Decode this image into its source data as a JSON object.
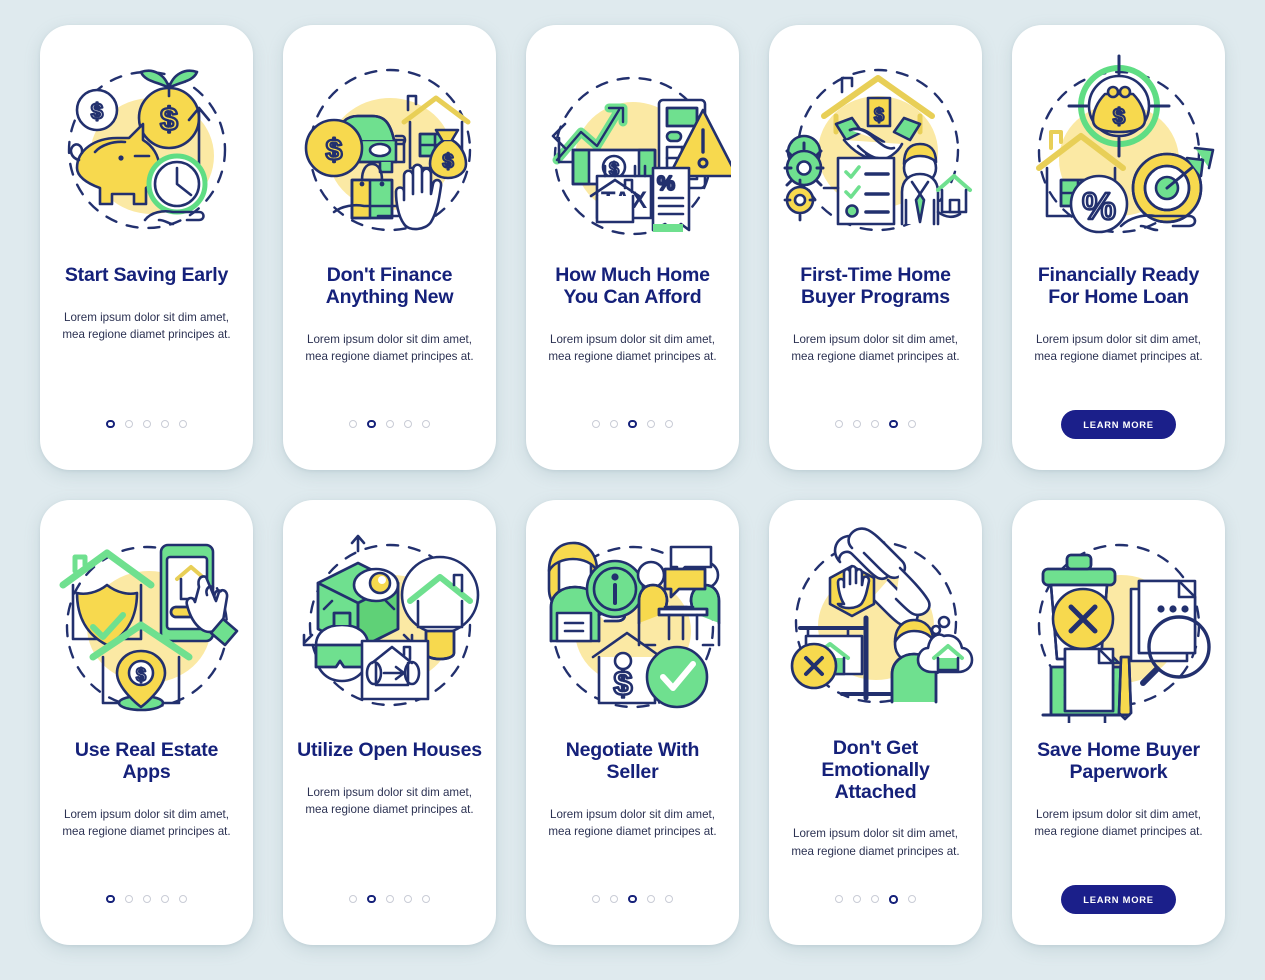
{
  "page": {
    "background_color": "#dfeaee",
    "card_background": "#ffffff",
    "title_color": "#15217a",
    "body_color": "#2b3152",
    "accent_navy": "#1b1f8a",
    "accent_green": "#5fdd84",
    "accent_yellow": "#f7d94e",
    "blob_yellow": "#fbe9a4",
    "dot_inactive": "#c9ccd6"
  },
  "shared": {
    "description": "Lorem ipsum dolor sit dim amet, mea regione diamet principes at.",
    "learn_more_label": "LEARN MORE",
    "dot_count": 5
  },
  "cards": [
    {
      "id": "start-saving-early",
      "title": "Start Saving Early",
      "description": "Lorem ipsum dolor sit dim amet, mea regione diamet principes at.",
      "footer_type": "dots",
      "active_dot": 1,
      "icon_name": "piggy-bank-savings-icon"
    },
    {
      "id": "dont-finance-anything-new",
      "title": "Don't Finance Anything New",
      "description": "Lorem ipsum dolor sit dim amet, mea regione diamet principes at.",
      "footer_type": "dots",
      "active_dot": 2,
      "icon_name": "car-house-shopping-stop-icon"
    },
    {
      "id": "how-much-home-you-can-afford",
      "title": "How Much Home You Can Afford",
      "description": "Lorem ipsum dolor sit dim amet, mea regione diamet principes at.",
      "footer_type": "dots",
      "active_dot": 3,
      "icon_name": "tax-calculator-affordability-icon"
    },
    {
      "id": "first-time-home-buyer-programs",
      "title": "First-Time Home Buyer Programs",
      "description": "Lorem ipsum dolor sit dim amet, mea regione diamet principes at.",
      "footer_type": "dots",
      "active_dot": 4,
      "icon_name": "handshake-checklist-agent-icon"
    },
    {
      "id": "financially-ready-for-home-loan",
      "title": "Financially Ready For Home Loan",
      "description": "Lorem ipsum dolor sit dim amet, mea regione diamet principes at.",
      "footer_type": "button",
      "button_label": "LEARN MORE",
      "icon_name": "target-purse-percent-house-icon"
    },
    {
      "id": "use-real-estate-apps",
      "title": "Use Real Estate Apps",
      "description": "Lorem ipsum dolor sit dim amet, mea regione diamet principes at.",
      "footer_type": "dots",
      "active_dot": 1,
      "icon_name": "house-phone-app-pin-icon"
    },
    {
      "id": "utilize-open-houses",
      "title": "Utilize Open Houses",
      "description": "Lorem ipsum dolor sit dim amet, mea regione diamet principes at.",
      "footer_type": "dots",
      "active_dot": 2,
      "icon_name": "vr-tour-magnifier-house-icon"
    },
    {
      "id": "negotiate-with-seller",
      "title": "Negotiate With Seller",
      "description": "Lorem ipsum dolor sit dim amet, mea regione diamet principes at.",
      "footer_type": "dots",
      "active_dot": 3,
      "icon_name": "agent-meeting-price-tag-check-icon"
    },
    {
      "id": "dont-get-emotionally-attached",
      "title": "Don't Get Emotionally Attached",
      "description": "Lorem ipsum dolor sit dim amet, mea regione diamet principes at.",
      "footer_type": "dots",
      "active_dot": 4,
      "icon_name": "broken-chain-sold-sign-icon"
    },
    {
      "id": "save-home-buyer-paperwork",
      "title": "Save Home Buyer Paperwork",
      "description": "Lorem ipsum dolor sit dim amet, mea regione diamet principes at.",
      "footer_type": "button",
      "button_label": "LEARN MORE",
      "icon_name": "trash-documents-magnifier-icon"
    }
  ]
}
